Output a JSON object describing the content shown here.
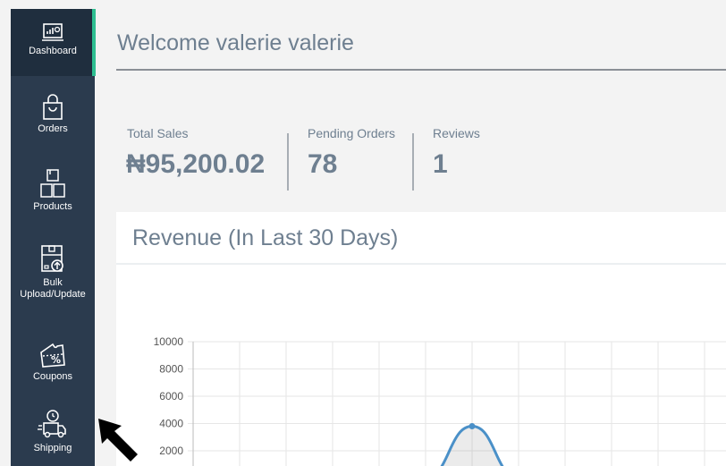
{
  "sidebar": {
    "items": [
      {
        "label": "Dashboard",
        "icon": "dashboard-icon",
        "active": true
      },
      {
        "label": "Orders",
        "icon": "shopping-bag-icon"
      },
      {
        "label": "Products",
        "icon": "boxes-icon"
      },
      {
        "label": "Bulk Upload/Update",
        "label_line1": "Bulk",
        "label_line2": "Upload/Update",
        "icon": "box-upload-icon"
      },
      {
        "label": "Coupons",
        "icon": "coupon-icon"
      },
      {
        "label": "Shipping",
        "icon": "delivery-truck-icon"
      }
    ]
  },
  "header": {
    "welcome": "Welcome valerie valerie"
  },
  "stats": [
    {
      "label": "Total Sales",
      "value": "₦95,200.02"
    },
    {
      "label": "Pending Orders",
      "value": "78"
    },
    {
      "label": "Reviews",
      "value": "1"
    }
  ],
  "revenue_card": {
    "title": "Revenue (In Last 30 Days)"
  },
  "colors": {
    "sidebar": "#2b3b4e",
    "accent": "#2ebf91",
    "line": "#4a90c8",
    "text": "#6e7f90"
  },
  "chart_data": {
    "type": "line",
    "title": "",
    "xlabel": "",
    "ylabel": "",
    "ylim": [
      0,
      10000
    ],
    "y_ticks": [
      "10000",
      "8000",
      "6000",
      "4000",
      "2000"
    ],
    "grid": true,
    "series": [
      {
        "x": [
          0,
          1,
          2,
          3,
          4,
          5,
          6,
          7,
          8,
          9,
          10,
          11
        ],
        "values": [
          0,
          0,
          0,
          0,
          0,
          0,
          3800,
          0,
          0,
          0,
          0,
          0
        ]
      }
    ]
  }
}
